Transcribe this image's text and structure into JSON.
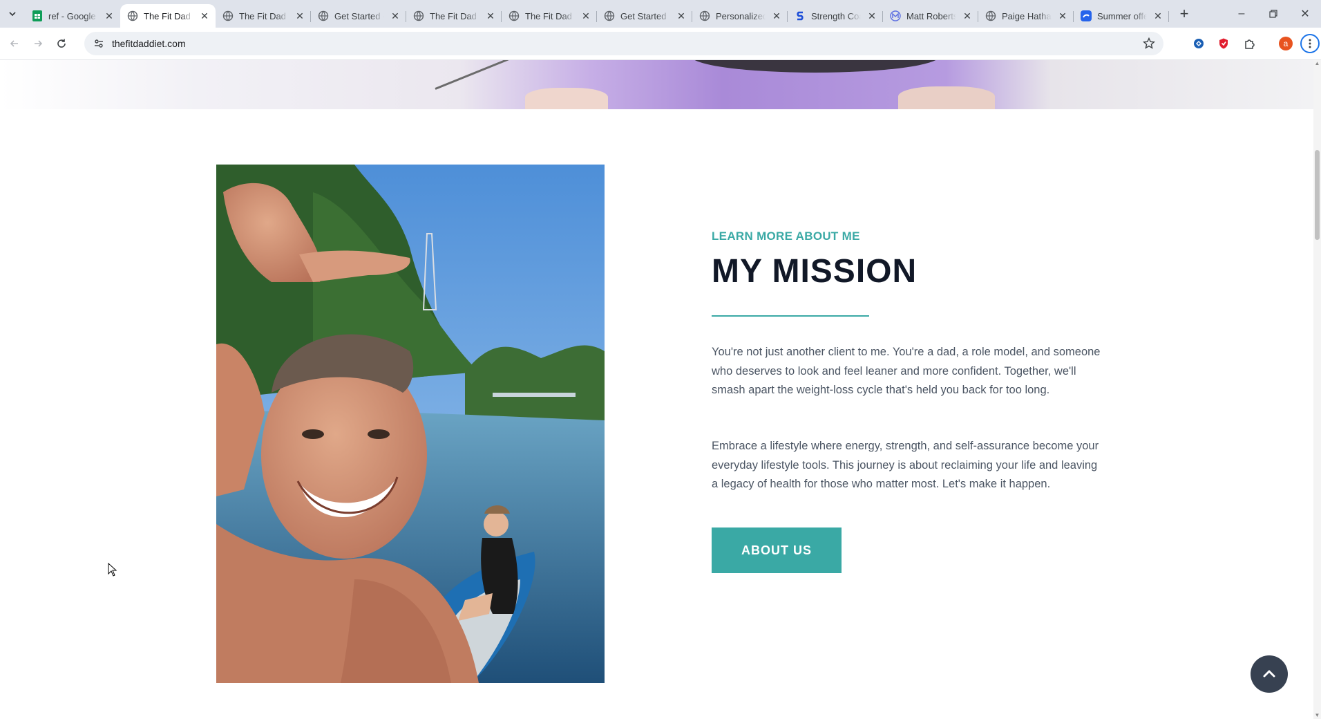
{
  "browser": {
    "tabs": [
      {
        "title": "ref - Google",
        "icon": "sheets-icon",
        "active": false
      },
      {
        "title": "The Fit Dad Diet",
        "icon": "globe-icon",
        "active": true
      },
      {
        "title": "The Fit Dad Diet",
        "icon": "globe-icon",
        "active": false
      },
      {
        "title": "Get Started - ",
        "icon": "globe-icon",
        "active": false
      },
      {
        "title": "The Fit Dad Diet",
        "icon": "globe-icon",
        "active": false
      },
      {
        "title": "The Fit Dad Diet",
        "icon": "globe-icon",
        "active": false
      },
      {
        "title": "Get Started",
        "icon": "globe-icon",
        "active": false
      },
      {
        "title": "Personalized",
        "icon": "globe-icon",
        "active": false
      },
      {
        "title": "Strength Coach",
        "icon": "strength-site-icon",
        "active": false
      },
      {
        "title": "Matt Roberts",
        "icon": "mr-site-icon",
        "active": false
      },
      {
        "title": "Paige Hathaway",
        "icon": "globe-icon",
        "active": false
      },
      {
        "title": "Summer offer",
        "icon": "summer-site-icon",
        "active": false
      }
    ],
    "url": "thefitdaddiet.com",
    "profile_initial": "a"
  },
  "page": {
    "eyebrow": "LEARN MORE ABOUT ME",
    "heading": "MY MISSION",
    "paragraph1": "You're not just another client to me. You're a dad, a role model, and someone who deserves to look and feel leaner and more confident. Together, we'll smash apart the weight-loss cycle that's held you back for too long.",
    "paragraph2": "Embrace a lifestyle where energy, strength, and self-assurance become your everyday lifestyle tools. This journey is about reclaiming your life and leaving a legacy of health for those who matter most. Let's make it happen.",
    "button_label": "ABOUT US"
  },
  "colors": {
    "accent": "#3aa9a5",
    "heading": "#111827",
    "body_text": "#4b5563",
    "scroll_button": "#374151"
  }
}
